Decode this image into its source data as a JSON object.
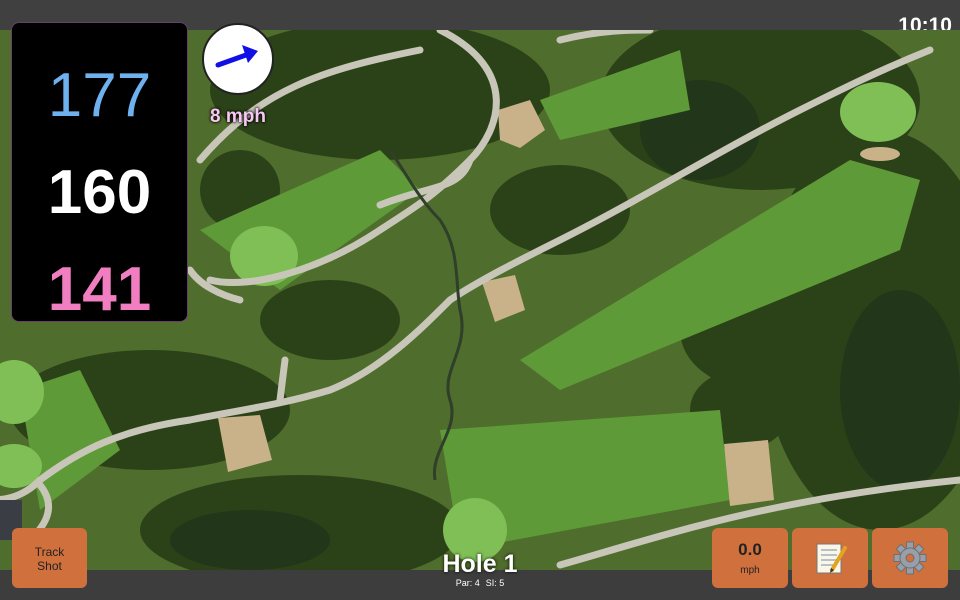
{
  "clock": "10:10",
  "yardage": {
    "back": "177",
    "middle": "160",
    "front": "141"
  },
  "wind": {
    "speed_label": "8 mph",
    "direction_icon": "arrow-right-icon"
  },
  "buttons": {
    "track_shot": {
      "line1": "Track",
      "line2": "Shot"
    },
    "speed": {
      "value": "0.0",
      "unit": "mph"
    },
    "notes_icon": "notepad-icon",
    "settings_icon": "gear-icon"
  },
  "hole": {
    "title": "Hole 1",
    "par": "Par: 4",
    "si": "SI: 5"
  },
  "colors": {
    "accent_button": "#d0703d",
    "back_yardage": "#6fb0ef",
    "front_yardage": "#f07ec0",
    "wind_label": "#f6c8f2",
    "wind_arrow": "#1010e6"
  }
}
